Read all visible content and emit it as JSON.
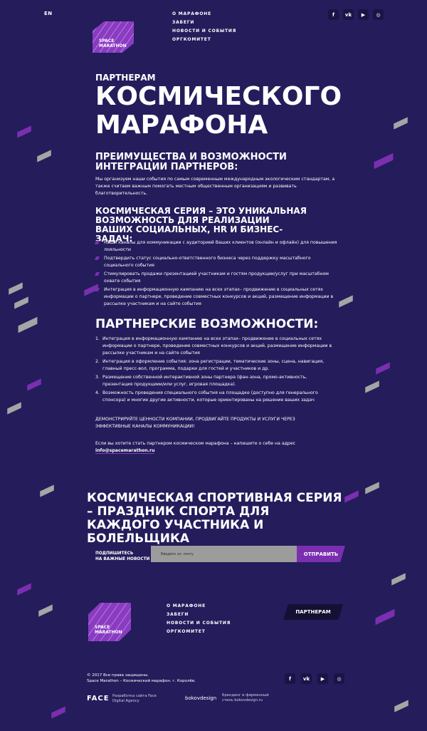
{
  "header": {
    "lang": "EN",
    "logo_text": [
      "SPACE",
      "MARATHON"
    ],
    "nav": [
      "О МАРАФОНЕ",
      "ЗАБЕГИ",
      "НОВОСТИ И СОБЫТИЯ",
      "ОРГКОМИТЕТ"
    ],
    "social": [
      {
        "icon": "facebook-icon",
        "glyph": "f"
      },
      {
        "icon": "vk-icon",
        "glyph": "vk"
      },
      {
        "icon": "youtube-icon",
        "glyph": "▶"
      },
      {
        "icon": "instagram-icon",
        "glyph": "◎"
      }
    ]
  },
  "hero": {
    "kicker": "ПАРТНЕРАМ",
    "title": "КОСМИЧЕСКОГО МАРАФОНА"
  },
  "section1": {
    "title": "ПРЕИМУЩЕСТВА И ВОЗМОЖНОСТИ ИНТЕГРАЦИИ ПАРТНЕРОВ:",
    "text": "Мы организуем наши события по самым современным международным экологическим стандартам, а также считаем важным помогать местным общественным организациям и развивать благотворительность."
  },
  "section2": {
    "title": "КОСМИЧЕСКАЯ СЕРИЯ – ЭТО УНИКАЛЬНАЯ ВОЗМОЖНОСТЬ ДЛЯ РЕАЛИЗАЦИИ ВАШИХ СОЦИАЛЬНЫХ, HR И БИЗНЕС-ЗАДАЧ:",
    "bullets": [
      "Наши каналы для коммуникации с аудиторией Ваших клиентов (онлайн и офлайн) для повышения лояльности",
      "Подтвердить статус социально-ответственного бизнеса через поддержку масштабного социального события",
      "Стимулировать продажи презентацией участникам и гостям продукции/услуг при масштабном охвате события",
      "Интеграция в информационную кампанию на всех этапах– продвижение в социальных сетях информации о партнере, проведение совместных конкурсов и акций, размещение информации в рассылке участникам и на сайте события"
    ]
  },
  "section3": {
    "title": "ПАРТНЕРСКИЕ ВОЗМОЖНОСТИ:",
    "items": [
      "Интеграция в информационную кампанию на всех этапах– продвижение в социальных сетях информации о партнере, проведение совместных конкурсов и акций, размещение информации в рассылке участникам и на сайте события",
      "Интеграция в оформление события: зона регистрации, тематические зоны, сцена, навигация, главный пресс-вол, программа, подарки для гостей и участников и др.",
      "Размещение собственной интерактивной зоны партнера (фан-зона, промо-активность, презентация продукциии/или услуг, игровая площадка).",
      "Возможность проведения специального события на площадке (доступно для генерального спонсора) и многие другие активности, которые ориентированы на решение ваших задач"
    ],
    "cta": "ДЕМОНСТРИРУЙТЕ ЦЕННОСТИ КОМПАНИИ, ПРОДВИГАЙТЕ ПРОДУКТЫ И УСЛУГИ ЧЕРЕЗ ЭФФЕКТИВНЫЕ КАНАЛЫ КОММУНИКАЦИИ!",
    "email_prefix": "Если вы хотите стать партнером космическом марафона – напишите о себе на адрес",
    "email": "info@spacemarathon.ru"
  },
  "sport": {
    "title": "КОСМИЧЕСКАЯ СПОРТИВНАЯ СЕРИЯ – ПРАЗДНИК СПОРТА ДЛЯ КАЖДОГО УЧАСТНИКА И БОЛЕЛЬЩИКА"
  },
  "subscribe": {
    "label_line1": "ПОДПИШИТЕСЬ",
    "label_line2": "НА ВАЖНЫЕ НОВОСТИ",
    "placeholder": "Введите эл. почту",
    "button": "ОТПРАВИТЬ"
  },
  "footer": {
    "logo_text": [
      "SPACE",
      "MARATHON"
    ],
    "nav": [
      "О МАРАФОНЕ",
      "ЗАБЕГИ",
      "НОВОСТИ И СОБЫТИЯ",
      "ОРГКОМИТЕТ"
    ],
    "partner_button": "ПАРТНЕРАМ",
    "copyright_line1": "© 2017 Все права защищены.",
    "copyright_line2": "Space Marathon – Космический марафон. г. Королёв.",
    "face_logo": "FACE",
    "face_text_line1": "Разработка сайта Face",
    "face_text_line2": "Digital Agency",
    "bokov_logo": "bokovdesign",
    "bokov_text_line1": "Брендинг и фирменный",
    "bokov_text_line2": "стиль bokovdesign.ru"
  },
  "colors": {
    "background": "#241c5b",
    "accent_purple": "#7a2fb0",
    "shard_gray": "#a5a5a5"
  }
}
